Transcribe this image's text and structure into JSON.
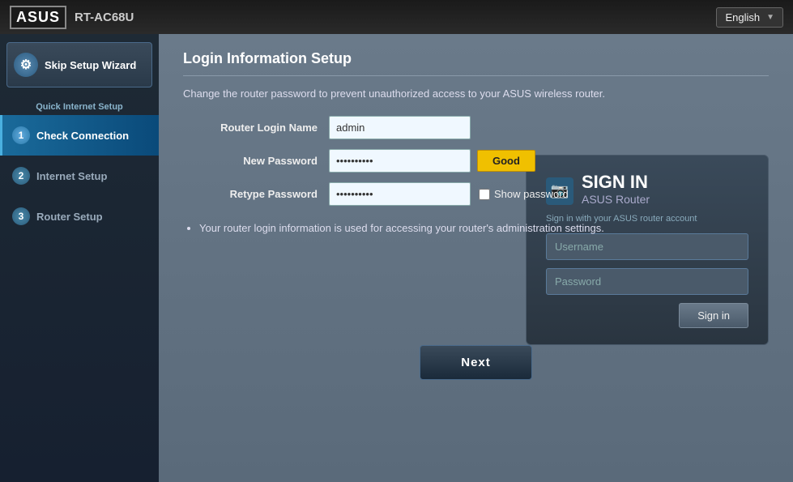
{
  "header": {
    "logo": "ASUS",
    "model": "RT-AC68U",
    "language": "English"
  },
  "sidebar": {
    "skip_label": "Skip Setup Wizard",
    "quick_title": "Quick Internet Setup",
    "items": [
      {
        "id": "check-connection",
        "num": "1",
        "label": "Check Connection",
        "active": true
      },
      {
        "id": "internet-setup",
        "num": "2",
        "label": "Internet Setup",
        "active": false
      },
      {
        "id": "router-setup",
        "num": "3",
        "label": "Router Setup",
        "active": false
      }
    ]
  },
  "main": {
    "page_title": "Login Information Setup",
    "description": "Change the router password to prevent unauthorized access to your ASUS wireless router.",
    "form": {
      "login_name_label": "Router Login Name",
      "login_name_value": "admin",
      "new_password_label": "New Password",
      "new_password_value": "••••••••••",
      "strength_label": "Good",
      "retype_password_label": "Retype Password",
      "retype_password_value": "••••••••••",
      "show_password_label": "Show password"
    },
    "info_bullets": [
      "Your router login information is used for accessing your router's administration settings."
    ],
    "signin_box": {
      "icon": "📷",
      "title": "SIGN IN",
      "subtitle": "ASUS Router",
      "description": "Sign in with your ASUS router account",
      "username_placeholder": "Username",
      "password_placeholder": "Password",
      "signin_button": "Sign in"
    },
    "next_button": "Next"
  }
}
